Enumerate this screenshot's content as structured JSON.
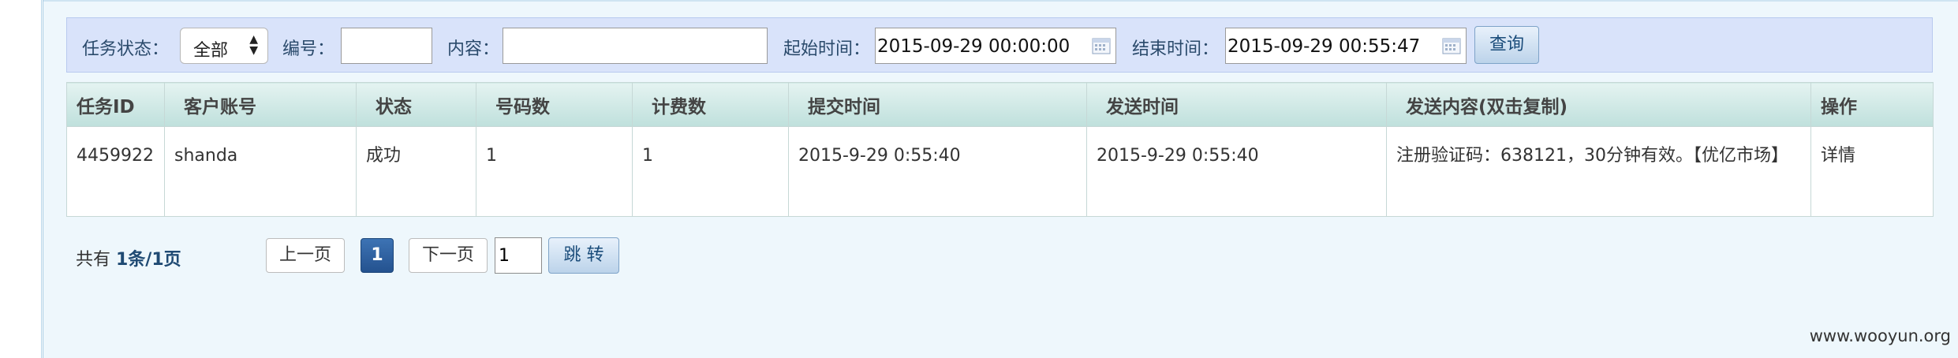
{
  "search": {
    "status_label": "任务状态：",
    "status_value": "全部",
    "code_label": "编号：",
    "code_value": "",
    "content_label": "内容：",
    "content_value": "",
    "start_label": "起始时间：",
    "start_value": "2015-09-29 00:00:00",
    "end_label": "结束时间：",
    "end_value": "2015-09-29 00:55:47",
    "query_label": "查询"
  },
  "table": {
    "headers": [
      "任务ID",
      "客户账号",
      "状态",
      "号码数",
      "计费数",
      "提交时间",
      "发送时间",
      "发送内容(双击复制)",
      "操作"
    ],
    "rows": [
      {
        "task_id": "4459922",
        "account": "shanda",
        "status": "成功",
        "numbers": "1",
        "billing": "1",
        "submit_time": "2015-9-29 0:55:40",
        "send_time": "2015-9-29 0:55:40",
        "content": "注册验证码：638121，30分钟有效。【优亿市场】",
        "action": "详情"
      }
    ]
  },
  "pager": {
    "total_prefix": "共有 ",
    "total_strong": "1条/1页",
    "prev": "上一页",
    "current": "1",
    "next": "下一页",
    "jump_value": "1",
    "jump": "跳 转"
  },
  "watermark": "www.wooyun.org"
}
